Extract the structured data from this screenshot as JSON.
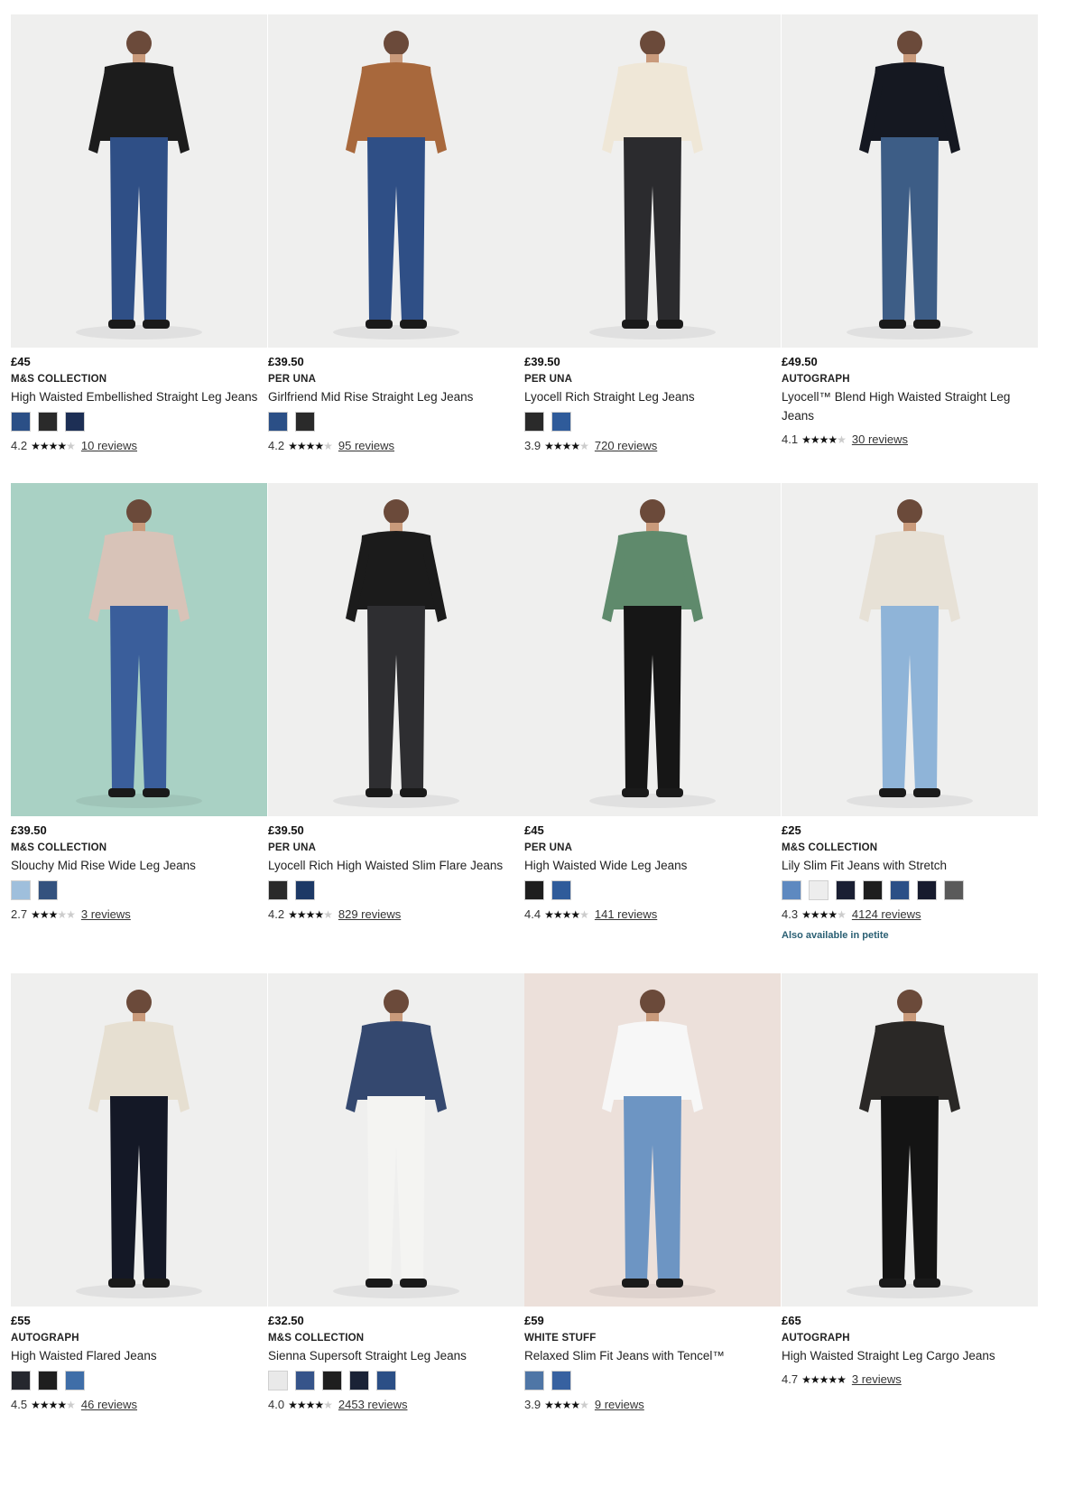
{
  "products": [
    {
      "price": "£45",
      "brand": "M&S COLLECTION",
      "title": "High Waisted Embellished Straight Leg Jeans",
      "swatches": [
        "#2b4f86",
        "#2a2a2a",
        "#1d2f55"
      ],
      "rating_value": "4.2",
      "stars": 4,
      "reviews": "10 reviews",
      "bg": "#efefee",
      "jeans": "#2f4f86",
      "top": "#1c1c1c",
      "extra": ""
    },
    {
      "price": "£39.50",
      "brand": "PER UNA",
      "title": "Girlfriend Mid Rise Straight Leg Jeans",
      "swatches": [
        "#2b4f86",
        "#2a2a2a"
      ],
      "rating_value": "4.2",
      "stars": 4,
      "reviews": "95 reviews",
      "bg": "#efefee",
      "jeans": "#2f4f86",
      "top": "#a8683c",
      "extra": ""
    },
    {
      "price": "£39.50",
      "brand": "PER UNA",
      "title": "Lyocell Rich Straight Leg Jeans",
      "swatches": [
        "#2a2a2a",
        "#2f5b9a"
      ],
      "rating_value": "3.9",
      "stars": 4,
      "reviews": "720 reviews",
      "bg": "#efefee",
      "jeans": "#2b2b2e",
      "top": "#efe7d7",
      "extra": ""
    },
    {
      "price": "£49.50",
      "brand": "AUTOGRAPH",
      "title": "Lyocell™ Blend High Waisted Straight Leg Jeans",
      "swatches": [],
      "rating_value": "4.1",
      "stars": 4,
      "reviews": "30 reviews",
      "bg": "#efefee",
      "jeans": "#3d5d86",
      "top": "#151821",
      "extra": ""
    },
    {
      "price": "£39.50",
      "brand": "M&S COLLECTION",
      "title": "Slouchy Mid Rise Wide Leg Jeans",
      "swatches": [
        "#9fbfdc",
        "#34527e"
      ],
      "rating_value": "2.7",
      "stars": 3,
      "reviews": "3 reviews",
      "bg": "#a9d1c4",
      "jeans": "#3a5e9b",
      "top": "#d8c3b8",
      "extra": ""
    },
    {
      "price": "£39.50",
      "brand": "PER UNA",
      "title": "Lyocell Rich High Waisted Slim Flare Jeans",
      "swatches": [
        "#2a2a2a",
        "#1d3966"
      ],
      "rating_value": "4.2",
      "stars": 4,
      "reviews": "829 reviews",
      "bg": "#efefee",
      "jeans": "#2e2e31",
      "top": "#1b1b1b",
      "extra": ""
    },
    {
      "price": "£45",
      "brand": "PER UNA",
      "title": "High Waisted Wide Leg Jeans",
      "swatches": [
        "#1e1e1e",
        "#2f5b9a"
      ],
      "rating_value": "4.4",
      "stars": 4,
      "reviews": "141 reviews",
      "bg": "#efefee",
      "jeans": "#161616",
      "top": "#5f8a6c",
      "extra": ""
    },
    {
      "price": "£25",
      "brand": "M&S COLLECTION",
      "title": "Lily Slim Fit Jeans with Stretch",
      "swatches": [
        "#5e89c0",
        "#ededed",
        "#1a1f33",
        "#1e1e1e",
        "#2b4f86",
        "#171b2e",
        "#5a5a5a"
      ],
      "rating_value": "4.3",
      "stars": 4,
      "reviews": "4124 reviews",
      "bg": "#efefee",
      "jeans": "#8fb4d8",
      "top": "#e7e1d6",
      "extra": "Also available in petite"
    },
    {
      "price": "£55",
      "brand": "AUTOGRAPH",
      "title": "High Waisted Flared Jeans",
      "swatches": [
        "#25272e",
        "#1e1e1e",
        "#3f6ea8"
      ],
      "rating_value": "4.5",
      "stars": 4,
      "reviews": "46 reviews",
      "bg": "#efefee",
      "jeans": "#141826",
      "top": "#e6dfd1",
      "extra": ""
    },
    {
      "price": "£32.50",
      "brand": "M&S COLLECTION",
      "title": "Sienna Supersoft Straight Leg Jeans",
      "swatches": [
        "#e9e9e9",
        "#36548a",
        "#1e1e1e",
        "#1a2236",
        "#2b4f86"
      ],
      "rating_value": "4.0",
      "stars": 4,
      "reviews": "2453 reviews",
      "bg": "#efefee",
      "jeans": "#f4f4f2",
      "top": "#34486f",
      "extra": ""
    },
    {
      "price": "£59",
      "brand": "WHITE STUFF",
      "title": "Relaxed Slim Fit Jeans with Tencel™",
      "swatches": [
        "#4f76a6",
        "#3761a0"
      ],
      "rating_value": "3.9",
      "stars": 4,
      "reviews": "9 reviews",
      "bg": "#ece0da",
      "jeans": "#6d95c3",
      "top": "#f7f7f7",
      "extra": ""
    },
    {
      "price": "£65",
      "brand": "AUTOGRAPH",
      "title": "High Waisted Straight Leg Cargo Jeans",
      "swatches": [],
      "rating_value": "4.7",
      "stars": 5,
      "reviews": "3 reviews",
      "bg": "#efefee",
      "jeans": "#141414",
      "top": "#2a2826",
      "extra": ""
    }
  ]
}
